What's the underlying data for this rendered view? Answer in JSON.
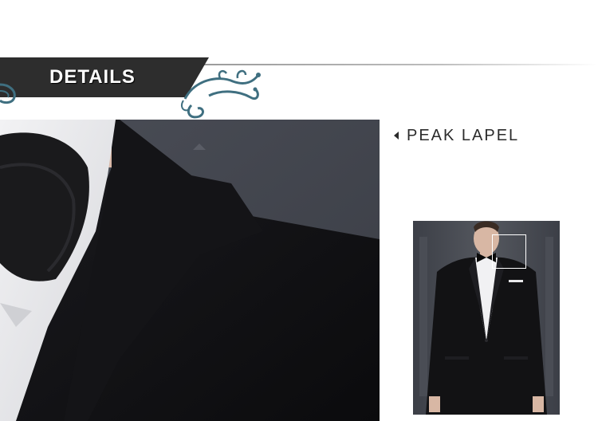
{
  "header": {
    "title": "DETAILS",
    "title_color": "#ffffff",
    "banner_color": "#2d2d2d",
    "ornament_color": "#3f6f80"
  },
  "feature": {
    "title": "PEAK LAPEL",
    "arrow_icon": "triangle-left-icon"
  },
  "images": {
    "detail": "close-up of peak lapel and black bow tie",
    "thumbnail": "model wearing black velvet tuxedo jacket"
  }
}
